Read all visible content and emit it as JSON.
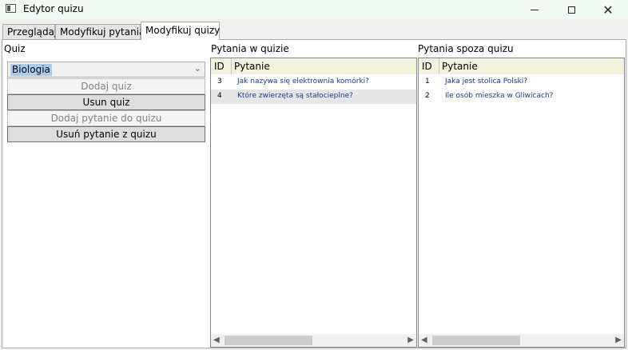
{
  "window": {
    "title": "Edytor quizu"
  },
  "tabs": [
    {
      "label": "Przeglądaj"
    },
    {
      "label": "Modyfikuj pytania"
    },
    {
      "label": "Modyfikuj quizy"
    }
  ],
  "active_tab": "Modyfikuj quizy",
  "quiz_panel": {
    "label": "Quiz",
    "combo_value": "Biologia",
    "buttons": {
      "add_quiz": "Dodaj quiz",
      "delete_quiz": "Usun quiz",
      "add_question": "Dodaj pytanie do quizu",
      "remove_question": "Usuń pytanie z quizu"
    }
  },
  "in_quiz": {
    "label": "Pytania w quizie",
    "headers": {
      "id": "ID",
      "question": "Pytanie"
    },
    "rows": [
      {
        "id": "3",
        "question": "Jak nazywa się elektrownia komórki?"
      },
      {
        "id": "4",
        "question": "Które zwierzęta są stałocieplne?"
      }
    ]
  },
  "outside_quiz": {
    "label": "Pytania spoza quizu",
    "headers": {
      "id": "ID",
      "question": "Pytanie"
    },
    "rows": [
      {
        "id": "1",
        "question": "Jaka jest stolica Polski?"
      },
      {
        "id": "2",
        "question": "Ile osób mieszka w Gliwicach?"
      }
    ]
  },
  "colors": {
    "titlebar": "#f3faf3",
    "grid_header": "#f3f3dc",
    "selection": "#a9cdef",
    "row_text": "#1f3b8c"
  }
}
